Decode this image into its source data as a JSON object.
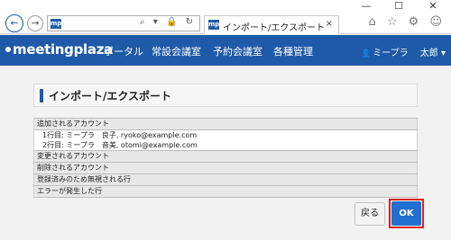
{
  "window": {
    "minimize": "—",
    "maximize": "☐",
    "close": "✕"
  },
  "browser": {
    "back_icon": "←",
    "forward_icon": "→",
    "favicon": "mp",
    "address_icons": "⌕ ▾ 🔒 ↻",
    "tab_title": "インポート/エクスポート",
    "tab_close": "×",
    "right_icons": "⌂ ☆ ⚙ ☺"
  },
  "navbar": {
    "logo": "meetingplaza",
    "menu": [
      "ポータル",
      "常設会議室",
      "予約会議室",
      "各種管理"
    ],
    "user_name": "ミープラ",
    "user_menu": "太郎 ▾"
  },
  "page": {
    "title": "インポート/エクスポート"
  },
  "results": {
    "added_header": "追加されるアカウント",
    "added_rows": [
      "1行目: ミープラ　良子, ryoko@example.com",
      "2行目: ミープラ　音美, otomi@example.com"
    ],
    "changed_header": "変更されるアカウント",
    "deleted_header": "削除されるアカウント",
    "ignored_header": "登録済みのため無視される行",
    "error_header": "エラーが発生した行"
  },
  "buttons": {
    "back": "戻る",
    "ok": "OK"
  },
  "colors": {
    "navbar": "#1e5aa8",
    "ok_button": "#1f6fd1",
    "highlight": "#e01f1f"
  }
}
